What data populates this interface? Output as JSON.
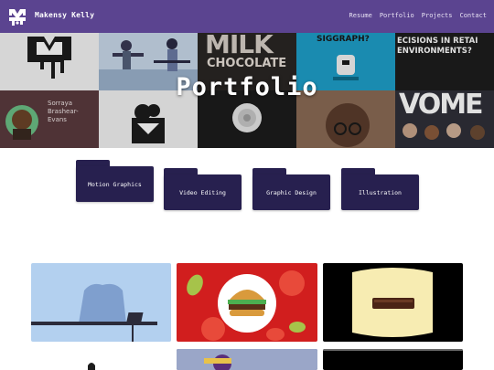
{
  "brand": {
    "name": "Makensy Kelly",
    "logo_icon": "mk-logo-icon"
  },
  "nav": {
    "links": [
      "Resume",
      "Portfolio",
      "Projects",
      "Contact"
    ]
  },
  "hero": {
    "title": "Portfolio",
    "tiles": [
      {
        "name": "mk-logo-tile",
        "caption": ""
      },
      {
        "name": "office-illustration-tile",
        "caption": ""
      },
      {
        "name": "milk-chocolate-tile",
        "caption": "MILK\nCHOCOLATE"
      },
      {
        "name": "siggraph-tile",
        "caption": "SIGGRAPH?"
      },
      {
        "name": "decisions-retail-tile",
        "caption": "ECISIONS IN RETAI\nENVIRONMENTS?"
      },
      {
        "name": "speaker-portrait-tile",
        "caption": "Sorraya\nBrashear-\nEvans"
      },
      {
        "name": "mk-logo-tile-2",
        "caption": ""
      },
      {
        "name": "flower-tile",
        "caption": ""
      },
      {
        "name": "woman-glasses-tile",
        "caption": ""
      },
      {
        "name": "women-event-tile",
        "caption": "VOME"
      }
    ]
  },
  "categories": [
    "Motion Graphics",
    "Video Editing",
    "Graphic Design",
    "Illustration"
  ],
  "projects": [
    {
      "name": "desk-scene-card"
    },
    {
      "name": "burger-card"
    },
    {
      "name": "chocolate-bar-card"
    }
  ],
  "colors": {
    "nav": "#5b4490",
    "folder": "#27204f",
    "background": "#ffffff"
  }
}
